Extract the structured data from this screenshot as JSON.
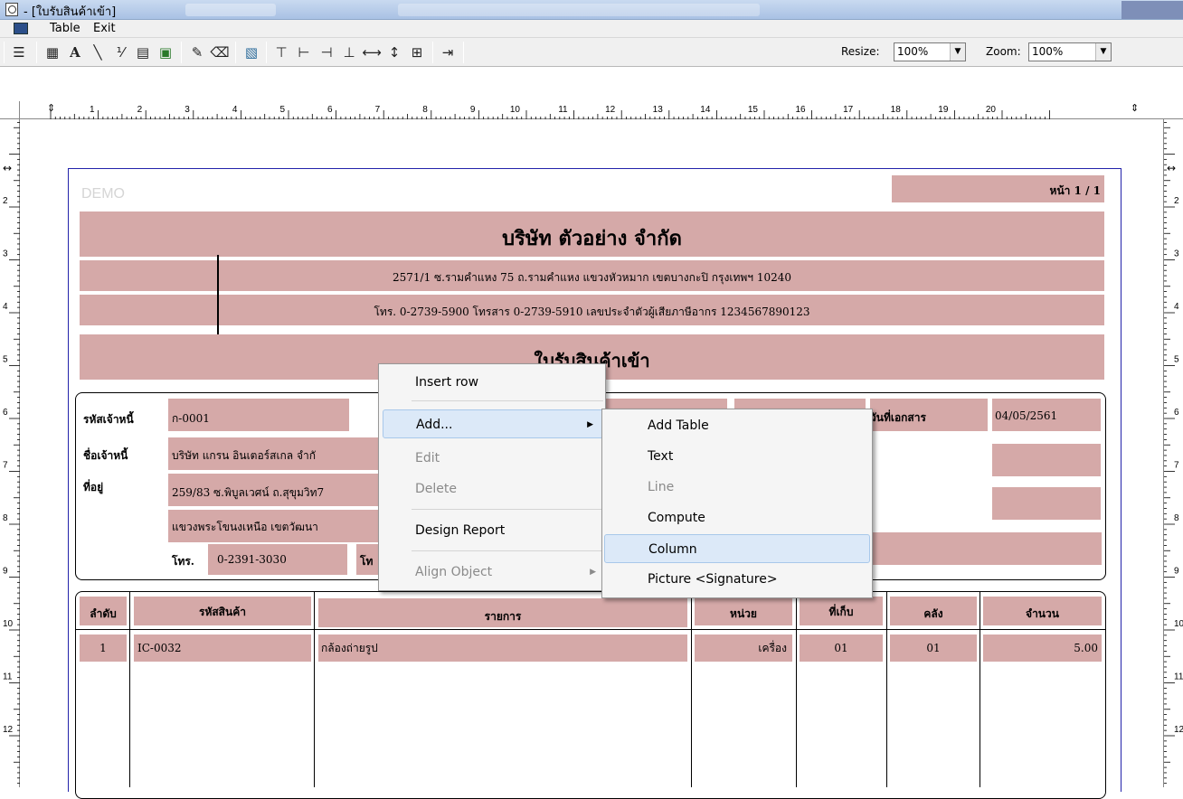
{
  "window": {
    "title": "- [ใบรับสินค้าเข้า]"
  },
  "menubar": {
    "items": [
      "Table",
      "Exit"
    ]
  },
  "toolbar": {
    "resize_label": "Resize:",
    "resize_value": "100%",
    "zoom_label": "Zoom:",
    "zoom_value": "100%"
  },
  "ruler": {
    "numbers": [
      "1",
      "2",
      "3",
      "4",
      "5",
      "6",
      "7",
      "8",
      "9",
      "10",
      "11",
      "12",
      "13",
      "14",
      "15",
      "16",
      "17",
      "18",
      "19",
      "20"
    ],
    "vnumbers": [
      "2",
      "3",
      "4",
      "5",
      "6",
      "7",
      "8",
      "9",
      "10",
      "11",
      "12"
    ]
  },
  "report": {
    "watermark": "DEMO",
    "page_number": "หน้า 1 / 1",
    "company_name": "บริษัท ตัวอย่าง จำกัด",
    "company_address": "2571/1 ซ.รามคำแหง 75 ถ.รามคำแหง แขวงหัวหมาก เขตบางกะปิ กรุงเทพฯ 10240",
    "company_contact": "โทร. 0-2739-5900  โทรสาร 0-2739-5910  เลขประจำตัวผู้เสียภาษีอากร 1234567890123",
    "doc_title": "ใบรับสินค้าเข้า",
    "creditor_code_label": "รหัสเจ้าหนี้",
    "creditor_code": "ก-0001",
    "creditor_name_label": "ชื่อเจ้าหนี้",
    "creditor_name": "บริษัท แกรน อินเตอร์สเกล จำกั",
    "address_label": "ที่อยู่",
    "address_line1": "259/83 ซ.พิบูลเวศน์ ถ.สุขุมวิท7",
    "address_line2": "แขวงพระโขนงเหนือ เขตวัฒนา",
    "phone_label": "โทร.",
    "phone": "0-2391-3030",
    "fax_label_partial": "โท",
    "doc_date_label": "วันที่เอกสาร",
    "doc_date": "04/05/2561",
    "columns": [
      "ลำดับ",
      "รหัสสินค้า",
      "รายการ",
      "หน่วย",
      "ที่เก็บ",
      "คลัง",
      "จำนวน"
    ],
    "rows": [
      {
        "no": "1",
        "code": "IC-0032",
        "name": "กล้องถ่ายรูป",
        "unit": "เครื่อง",
        "location": "01",
        "warehouse": "01",
        "qty": "5.00"
      }
    ]
  },
  "context_menu": {
    "items": [
      {
        "label": "Insert row",
        "enabled": true
      },
      {
        "label": "Add...",
        "enabled": true
      },
      {
        "label": "Edit",
        "enabled": false
      },
      {
        "label": "Delete",
        "enabled": false
      },
      {
        "label": "Design Report",
        "enabled": true
      },
      {
        "label": "Align Object",
        "enabled": false
      }
    ]
  },
  "submenu": {
    "items": [
      {
        "label": "Add Table",
        "enabled": true
      },
      {
        "label": "Text",
        "enabled": true
      },
      {
        "label": "Line",
        "enabled": false
      },
      {
        "label": "Compute",
        "enabled": true
      },
      {
        "label": "Column",
        "enabled": true,
        "highlighted": true
      },
      {
        "label": "Picture <Signature>",
        "enabled": true
      }
    ]
  }
}
